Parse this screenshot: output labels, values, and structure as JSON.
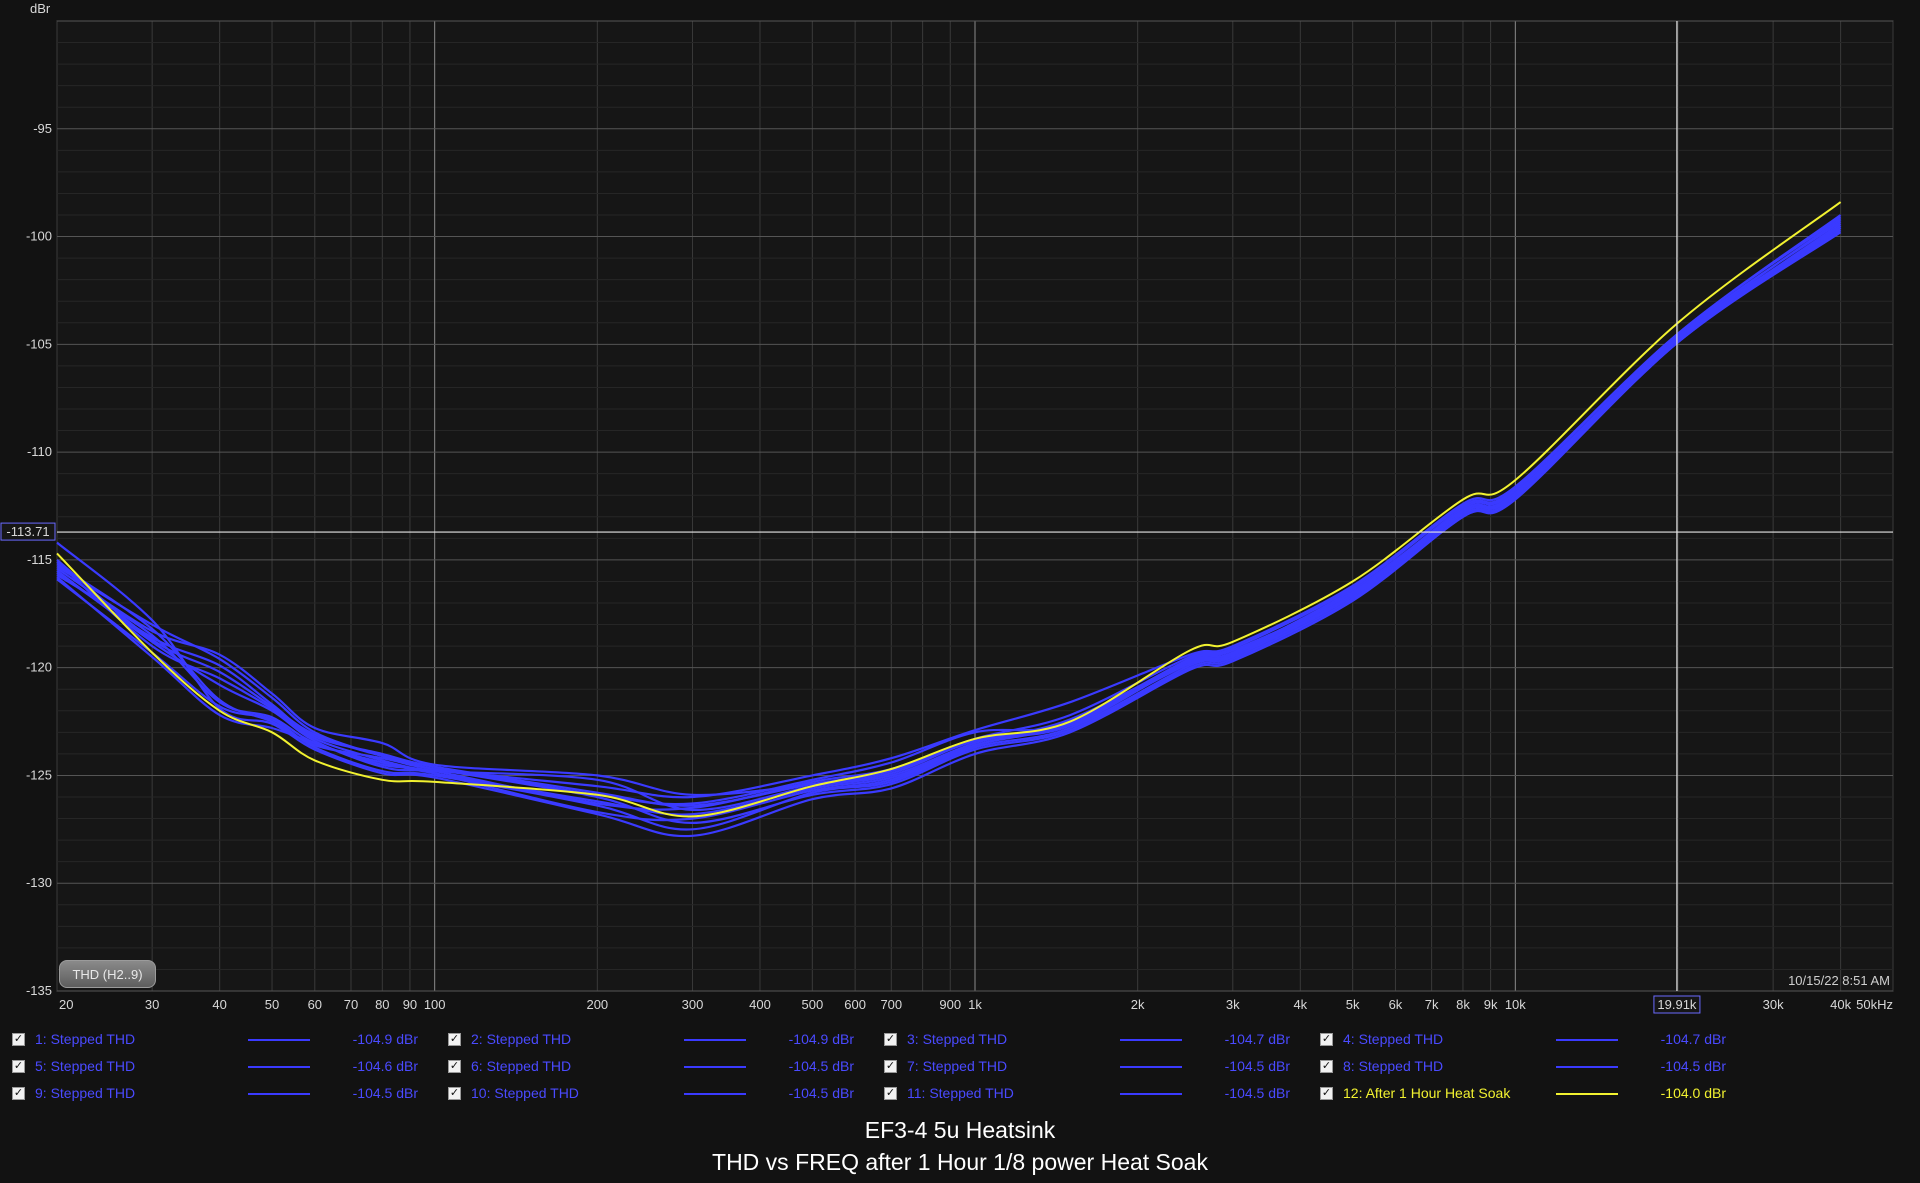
{
  "chart_data": {
    "type": "line",
    "title": "EF3-4 5u Heatsink",
    "subtitle": "THD vs FREQ after 1 Hour 1/8 power Heat Soak",
    "ylabel": "dBr",
    "xlabel": "",
    "x_scale": "log",
    "xlim": [
      20,
      50000
    ],
    "ylim": [
      -135,
      -90
    ],
    "grid": true,
    "y_ticks": [
      {
        "v": -95,
        "label": "-95"
      },
      {
        "v": -100,
        "label": "-100"
      },
      {
        "v": -105,
        "label": "-105"
      },
      {
        "v": -110,
        "label": "-110"
      },
      {
        "v": -115,
        "label": "-115"
      },
      {
        "v": -120,
        "label": "-120"
      },
      {
        "v": -125,
        "label": "-125"
      },
      {
        "v": -130,
        "label": "-130"
      },
      {
        "v": -135,
        "label": "-135"
      }
    ],
    "x_ticks": [
      {
        "v": 20,
        "label": "20"
      },
      {
        "v": 30,
        "label": "30"
      },
      {
        "v": 40,
        "label": "40"
      },
      {
        "v": 50,
        "label": "50"
      },
      {
        "v": 60,
        "label": "60"
      },
      {
        "v": 70,
        "label": "70"
      },
      {
        "v": 80,
        "label": "80"
      },
      {
        "v": 90,
        "label": "90"
      },
      {
        "v": 100,
        "label": "100"
      },
      {
        "v": 200,
        "label": "200"
      },
      {
        "v": 300,
        "label": "300"
      },
      {
        "v": 400,
        "label": "400"
      },
      {
        "v": 500,
        "label": "500"
      },
      {
        "v": 600,
        "label": "600"
      },
      {
        "v": 700,
        "label": "700"
      },
      {
        "v": 900,
        "label": "900"
      },
      {
        "v": 1000,
        "label": "1k"
      },
      {
        "v": 2000,
        "label": "2k"
      },
      {
        "v": 3000,
        "label": "3k"
      },
      {
        "v": 4000,
        "label": "4k"
      },
      {
        "v": 5000,
        "label": "5k"
      },
      {
        "v": 6000,
        "label": "6k"
      },
      {
        "v": 7000,
        "label": "7k"
      },
      {
        "v": 8000,
        "label": "8k"
      },
      {
        "v": 9000,
        "label": "9k"
      },
      {
        "v": 10000,
        "label": "10k"
      },
      {
        "v": 30000,
        "label": "30k"
      },
      {
        "v": 40000,
        "label": "40k"
      },
      {
        "v": 50000,
        "label": "50kHz"
      }
    ],
    "cursor": {
      "x": 19910,
      "x_label": "19.91k",
      "y": -113.71,
      "y_label": "-113.71"
    },
    "series": [
      {
        "name": "1: Stepped THD",
        "value": "-104.9 dBr",
        "color": "#3a3aff",
        "x": [
          20,
          30,
          40,
          50,
          60,
          80,
          100,
          200,
          300,
          500,
          700,
          1000,
          1500,
          2500,
          3000,
          5000,
          8000,
          10000,
          20000,
          40000
        ],
        "y": [
          -115.3,
          -118.0,
          -119.6,
          -121.4,
          -123.0,
          -124.1,
          -124.7,
          -125.5,
          -126.0,
          -125.0,
          -124.2,
          -122.9,
          -121.6,
          -119.4,
          -119.0,
          -116.2,
          -112.4,
          -111.6,
          -104.5,
          -99.0
        ]
      },
      {
        "name": "2: Stepped THD",
        "value": "-104.9 dBr",
        "color": "#3a3aff",
        "x": [
          20,
          30,
          40,
          50,
          60,
          80,
          100,
          200,
          300,
          500,
          700,
          1000,
          1500,
          2500,
          3000,
          5000,
          8000,
          10000,
          20000,
          40000
        ],
        "y": [
          -115.8,
          -119.5,
          -122.2,
          -122.8,
          -123.5,
          -124.5,
          -124.8,
          -126.3,
          -126.5,
          -125.3,
          -124.7,
          -123.3,
          -122.2,
          -119.5,
          -119.1,
          -116.3,
          -112.5,
          -111.7,
          -104.5,
          -99.1
        ]
      },
      {
        "name": "3: Stepped THD",
        "value": "-104.7 dBr",
        "color": "#3a3aff",
        "x": [
          20,
          30,
          40,
          50,
          60,
          80,
          100,
          200,
          300,
          500,
          700,
          1000,
          1500,
          2500,
          3000,
          5000,
          8000,
          10000,
          20000,
          40000
        ],
        "y": [
          -115.6,
          -118.6,
          -119.9,
          -121.7,
          -123.2,
          -124.0,
          -124.6,
          -125.9,
          -126.3,
          -125.2,
          -124.4,
          -123.0,
          -122.6,
          -119.6,
          -119.2,
          -116.5,
          -112.6,
          -111.8,
          -104.7,
          -99.2
        ]
      },
      {
        "name": "4: Stepped THD",
        "value": "-104.7 dBr",
        "color": "#3a3aff",
        "x": [
          20,
          30,
          40,
          50,
          60,
          80,
          100,
          200,
          300,
          500,
          700,
          1000,
          1500,
          2500,
          3000,
          5000,
          8000,
          10000,
          20000,
          40000
        ],
        "y": [
          -115.4,
          -118.3,
          -119.4,
          -121.2,
          -122.8,
          -123.5,
          -124.5,
          -125.0,
          -125.9,
          -125.4,
          -124.9,
          -123.4,
          -122.7,
          -119.7,
          -119.3,
          -116.4,
          -112.7,
          -111.9,
          -104.6,
          -99.3
        ]
      },
      {
        "name": "5: Stepped THD",
        "value": "-104.6 dBr",
        "color": "#3a3aff",
        "x": [
          20,
          30,
          40,
          50,
          60,
          80,
          100,
          200,
          300,
          500,
          700,
          1000,
          1500,
          2500,
          3000,
          5000,
          8000,
          10000,
          20000,
          40000
        ],
        "y": [
          -115.1,
          -119.0,
          -120.5,
          -121.9,
          -123.3,
          -124.3,
          -124.9,
          -126.7,
          -127.0,
          -125.7,
          -125.2,
          -123.6,
          -122.5,
          -119.8,
          -119.4,
          -116.6,
          -112.8,
          -112.0,
          -104.8,
          -99.4
        ]
      },
      {
        "name": "6: Stepped THD",
        "value": "-104.5 dBr",
        "color": "#3a3aff",
        "x": [
          20,
          30,
          40,
          50,
          60,
          80,
          100,
          200,
          300,
          500,
          700,
          1000,
          1500,
          2500,
          3000,
          5000,
          8000,
          10000,
          20000,
          40000
        ],
        "y": [
          -115.9,
          -119.3,
          -121.8,
          -122.4,
          -123.7,
          -124.8,
          -125.0,
          -126.4,
          -127.5,
          -125.8,
          -125.3,
          -123.7,
          -122.8,
          -119.9,
          -119.5,
          -116.7,
          -112.9,
          -112.1,
          -104.9,
          -99.5
        ]
      },
      {
        "name": "7: Stepped THD",
        "value": "-104.5 dBr",
        "color": "#3a3aff",
        "x": [
          20,
          30,
          40,
          50,
          60,
          80,
          100,
          200,
          300,
          500,
          700,
          1000,
          1500,
          2500,
          3000,
          5000,
          8000,
          10000,
          20000,
          40000
        ],
        "y": [
          -115.5,
          -118.8,
          -120.8,
          -122.0,
          -123.4,
          -124.6,
          -124.8,
          -125.2,
          -126.6,
          -125.5,
          -125.0,
          -123.5,
          -122.4,
          -119.7,
          -119.4,
          -116.5,
          -112.7,
          -111.9,
          -104.8,
          -99.6
        ]
      },
      {
        "name": "8: Stepped THD",
        "value": "-104.5 dBr",
        "color": "#3a3aff",
        "x": [
          20,
          30,
          40,
          50,
          60,
          80,
          100,
          200,
          300,
          500,
          700,
          1000,
          1500,
          2500,
          3000,
          5000,
          8000,
          10000,
          20000,
          40000
        ],
        "y": [
          -115.2,
          -118.2,
          -121.5,
          -122.5,
          -123.6,
          -124.2,
          -124.7,
          -126.0,
          -127.2,
          -125.9,
          -125.4,
          -123.8,
          -122.9,
          -120.0,
          -119.6,
          -116.8,
          -113.0,
          -112.1,
          -104.9,
          -99.7
        ]
      },
      {
        "name": "9: Stepped THD",
        "value": "-104.5 dBr",
        "color": "#3a3aff",
        "x": [
          20,
          30,
          40,
          50,
          60,
          80,
          100,
          200,
          300,
          500,
          700,
          1000,
          1500,
          2500,
          3000,
          5000,
          8000,
          10000,
          20000,
          40000
        ],
        "y": [
          -114.2,
          -117.8,
          -121.9,
          -122.6,
          -123.8,
          -124.9,
          -125.1,
          -126.8,
          -127.8,
          -126.1,
          -125.6,
          -124.0,
          -123.0,
          -120.1,
          -119.7,
          -116.9,
          -113.0,
          -112.2,
          -104.9,
          -99.8
        ]
      },
      {
        "name": "10: Stepped THD",
        "value": "-104.5 dBr",
        "color": "#3a3aff",
        "x": [
          20,
          30,
          40,
          50,
          60,
          80,
          100,
          200,
          300,
          500,
          700,
          1000,
          1500,
          2500,
          3000,
          5000,
          8000,
          10000,
          20000,
          40000
        ],
        "y": [
          -115.7,
          -118.5,
          -121.6,
          -122.3,
          -123.5,
          -124.4,
          -124.9,
          -126.2,
          -126.8,
          -125.6,
          -125.1,
          -123.6,
          -122.6,
          -119.8,
          -119.5,
          -116.6,
          -112.8,
          -112.0,
          -104.8,
          -99.6
        ]
      },
      {
        "name": "11: Stepped THD",
        "value": "-104.5 dBr",
        "color": "#3a3aff",
        "x": [
          20,
          30,
          40,
          50,
          60,
          80,
          100,
          200,
          300,
          500,
          700,
          1000,
          1500,
          2500,
          3000,
          5000,
          8000,
          10000,
          20000,
          40000
        ],
        "y": [
          -115.0,
          -118.7,
          -120.2,
          -121.8,
          -123.1,
          -124.1,
          -124.6,
          -125.8,
          -126.4,
          -125.4,
          -124.8,
          -123.4,
          -122.5,
          -119.6,
          -119.3,
          -116.5,
          -112.7,
          -111.9,
          -104.7,
          -99.5
        ]
      },
      {
        "name": "12: After 1 Hour Heat Soak",
        "value": "-104.0 dBr",
        "color": "#f2f230",
        "x": [
          20,
          30,
          40,
          50,
          60,
          80,
          100,
          200,
          300,
          500,
          700,
          1000,
          1500,
          2500,
          3000,
          5000,
          8000,
          10000,
          20000,
          40000
        ],
        "y": [
          -114.7,
          -119.3,
          -122.0,
          -123.0,
          -124.3,
          -125.2,
          -125.3,
          -125.9,
          -126.9,
          -125.5,
          -124.7,
          -123.3,
          -122.5,
          -119.2,
          -118.8,
          -116.0,
          -112.2,
          -111.3,
          -104.0,
          -98.4
        ]
      }
    ]
  },
  "ui": {
    "measurement_button": "THD (H2..9)",
    "timestamp": "10/15/22 8:51 AM",
    "check_mark": "✓"
  }
}
